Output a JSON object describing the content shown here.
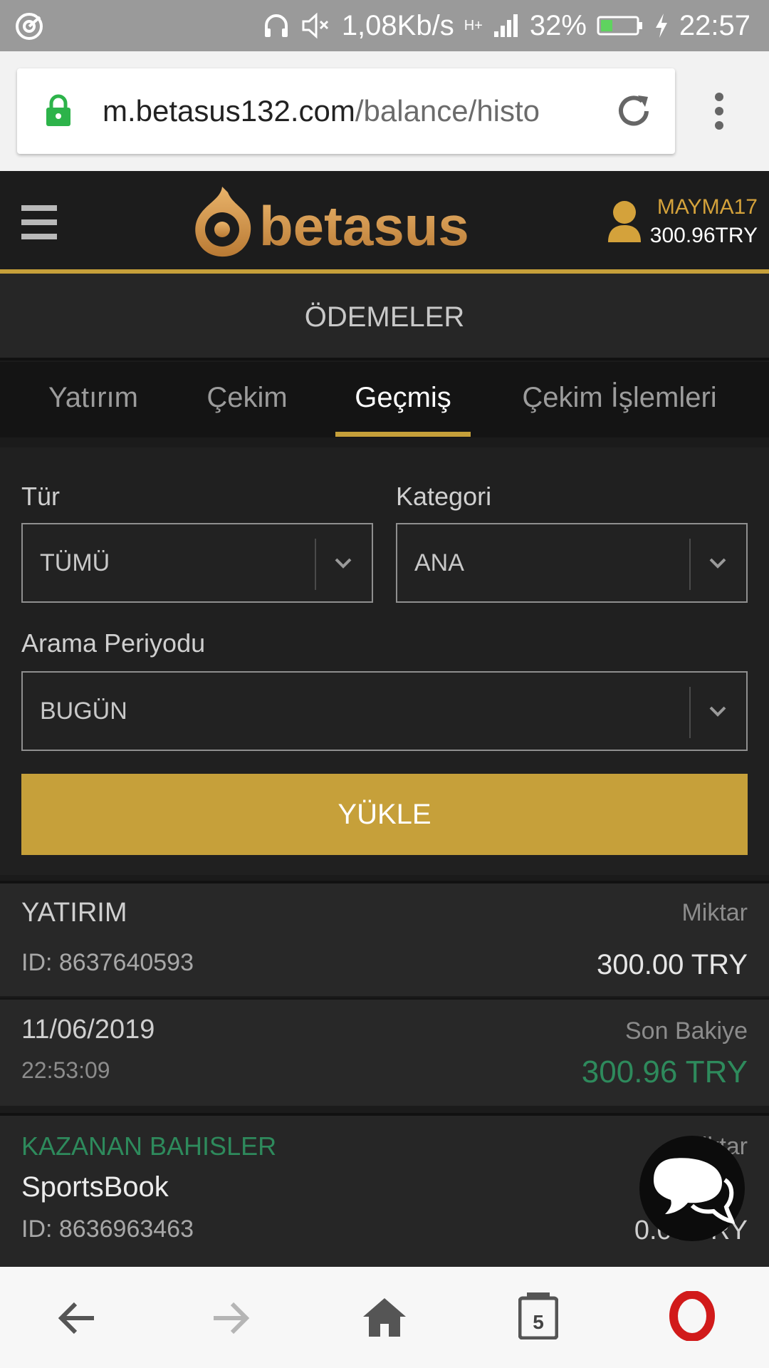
{
  "status_bar": {
    "speed": "1,08Kb/s",
    "network": "H+",
    "battery": "32%",
    "time": "22:57"
  },
  "browser": {
    "url_host": "m.betasus132.com",
    "url_path": "/balance/histo",
    "tab_count": "5"
  },
  "header": {
    "logo_text": "betasus",
    "username": "MAYMA17",
    "balance": "300.96TRY"
  },
  "page": {
    "title": "ÖDEMELER"
  },
  "tabs": [
    {
      "label": "Yatırım"
    },
    {
      "label": "Çekim"
    },
    {
      "label": "Geçmiş",
      "active": true
    },
    {
      "label": "Çekim İşlemleri"
    }
  ],
  "filters": {
    "type_label": "Tür",
    "type_value": "TÜMÜ",
    "category_label": "Kategori",
    "category_value": "ANA",
    "period_label": "Arama Periyodu",
    "period_value": "BUGÜN",
    "load_button": "YÜKLE"
  },
  "transactions": [
    {
      "type": "YATIRIM",
      "id": "ID: 8637640593",
      "amount_label": "Miktar",
      "amount": "300.00 TRY",
      "date": "11/06/2019",
      "time": "22:53:09",
      "balance_label": "Son Bakiye",
      "balance": "300.96 TRY"
    },
    {
      "type": "KAZANAN BAHISLER",
      "source": "SportsBook",
      "id": "ID: 8636963463",
      "amount_label": "Miktar",
      "amount": "0.00 TRY"
    }
  ],
  "colors": {
    "gold": "#c6a03a",
    "green": "#2e8a5c",
    "user_gold": "#d4a23b"
  },
  "icons": {
    "chat": "chat-bubbles-icon",
    "back": "arrow-left-icon",
    "forward": "arrow-right-icon",
    "home": "home-icon",
    "tabs": "tabs-icon",
    "opera": "opera-logo-icon"
  }
}
